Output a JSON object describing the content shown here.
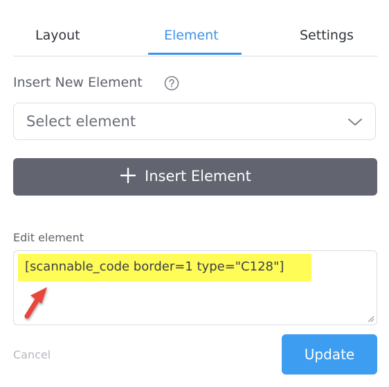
{
  "tabs": [
    {
      "label": "Layout"
    },
    {
      "label": "Element"
    },
    {
      "label": "Settings"
    }
  ],
  "active_tab": "Element",
  "insert": {
    "label": "Insert New Element",
    "select_placeholder": "Select element",
    "button_label": "Insert Element"
  },
  "edit": {
    "label": "Edit element",
    "code": "[scannable_code border=1 type=\"C128\"]"
  },
  "footer": {
    "cancel_label": "Cancel",
    "update_label": "Update"
  },
  "colors": {
    "accent": "#3d93e8",
    "insert_button": "#62656f",
    "update_button": "#3d9df0",
    "highlight": "#fffb57",
    "annotation_arrow": "#e8453c"
  },
  "icons": {
    "help": "help-circle-icon",
    "dropdown": "chevron-down-icon",
    "insert": "plus-icon",
    "annotation": "red-arrow-icon"
  }
}
